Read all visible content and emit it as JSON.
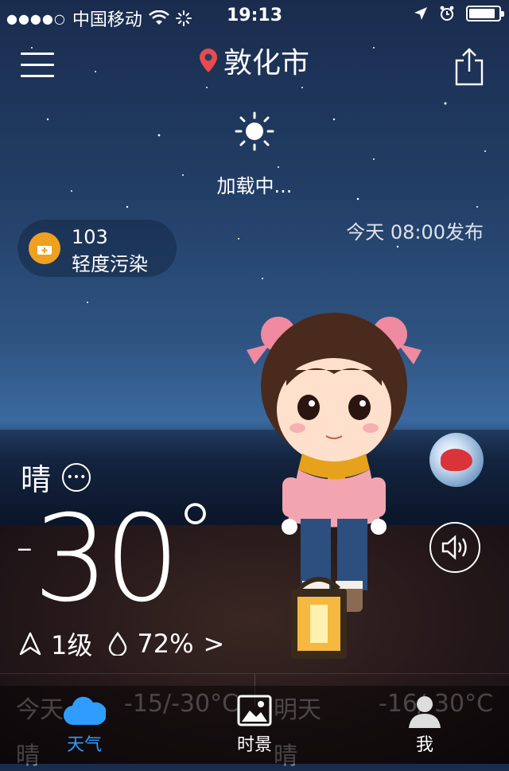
{
  "status_bar": {
    "signal_dots": "●●●●○",
    "carrier": "中国移动",
    "time": "19:13",
    "battery_level": 0.9
  },
  "header": {
    "city": "敦化市",
    "menu_icon": "hamburger-menu-icon",
    "share_icon": "share-icon",
    "location_icon": "location-pin-icon",
    "location_color": "#e84b4b"
  },
  "weather": {
    "loading_text": "加载中...",
    "publish_time": "今天 08:00发布",
    "aqi_value": "103",
    "aqi_level": "轻度污染",
    "aqi_color": "#f0a020",
    "condition": "晴",
    "temp_sign": "-",
    "temp_value": "30",
    "temp_unit": "°",
    "wind_level": "1级",
    "humidity": "72%",
    "more_arrow": ">"
  },
  "forecast_underlay": {
    "today_label": "今天",
    "today_range": "-15/-30°C",
    "today_condition": "晴",
    "tomorrow_label": "明天",
    "tomorrow_range": "-16/-30°C",
    "tomorrow_condition": "晴"
  },
  "tabs": [
    {
      "label": "天气",
      "icon": "cloud-icon",
      "active": true
    },
    {
      "label": "时景",
      "icon": "photo-icon",
      "active": false
    },
    {
      "label": "我",
      "icon": "person-icon",
      "active": false
    }
  ],
  "colors": {
    "active_tab": "#2f9cff",
    "aqi_badge": "#f0a020"
  }
}
